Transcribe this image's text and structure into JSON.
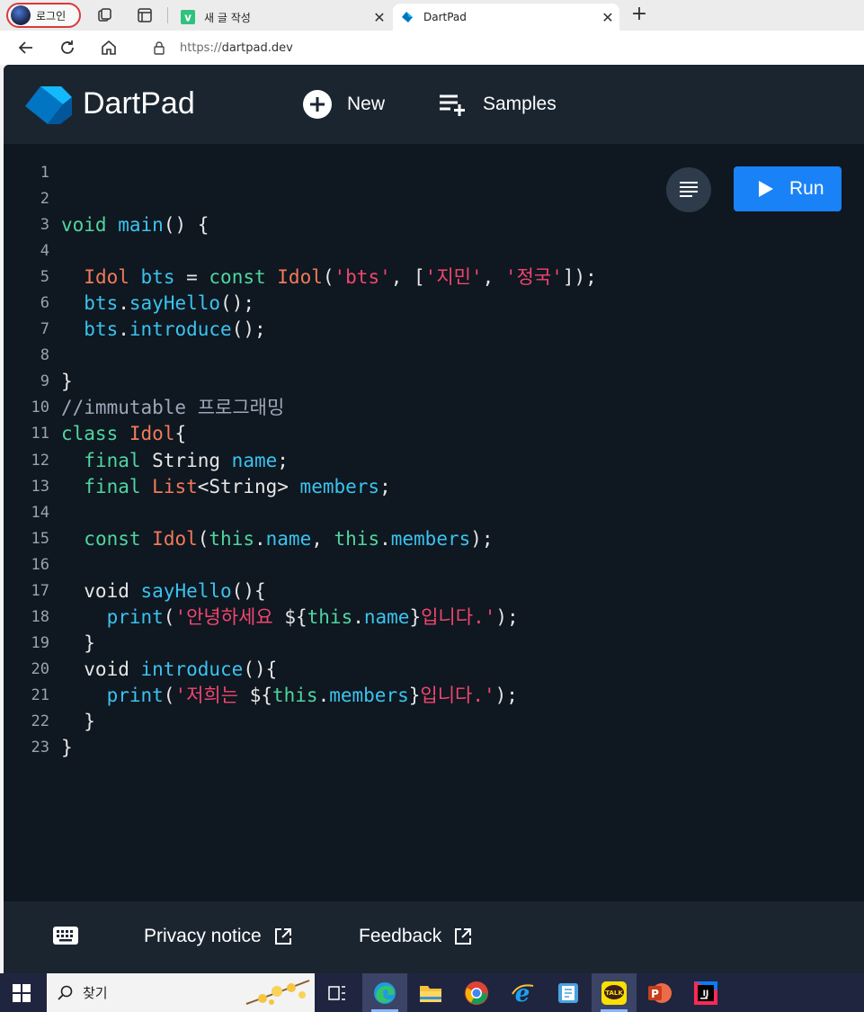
{
  "browser": {
    "profile_label": "로그인",
    "tabs": [
      {
        "title": "새 글 작성",
        "close": "✕",
        "favicon": "vlog-v-icon"
      },
      {
        "title": "DartPad",
        "close": "✕",
        "favicon": "dart-icon"
      }
    ],
    "new_tab": "+",
    "url_protocol": "https://",
    "url_host": "dartpad.dev"
  },
  "dartpad": {
    "brand": "DartPad",
    "new_label": "New",
    "samples_label": "Samples",
    "run_label": "Run",
    "footer": {
      "privacy": "Privacy notice",
      "feedback": "Feedback"
    },
    "colors": {
      "run_button": "#1a82f7",
      "keyword": "#4fd6a0",
      "type": "#f27a5a",
      "identifier": "#3ac3ee",
      "string": "#f0466f",
      "comment": "#9fa6b8"
    }
  },
  "editor": {
    "line_numbers": [
      "1",
      "2",
      "3",
      "4",
      "5",
      "6",
      "7",
      "8",
      "9",
      "10",
      "11",
      "12",
      "13",
      "14",
      "15",
      "16",
      "17",
      "18",
      "19",
      "20",
      "21",
      "22",
      "23"
    ],
    "lines": [
      [],
      [],
      [
        [
          "k",
          "void"
        ],
        [
          "p",
          " "
        ],
        [
          "f",
          "main"
        ],
        [
          "p",
          "() {"
        ]
      ],
      [],
      [
        [
          "p",
          "  "
        ],
        [
          "t",
          "Idol"
        ],
        [
          "p",
          " "
        ],
        [
          "f",
          "bts"
        ],
        [
          "p",
          " = "
        ],
        [
          "k",
          "const"
        ],
        [
          "p",
          " "
        ],
        [
          "t",
          "Idol"
        ],
        [
          "p",
          "("
        ],
        [
          "s",
          "'bts'"
        ],
        [
          "p",
          ", ["
        ],
        [
          "s",
          "'지민'"
        ],
        [
          "p",
          ", "
        ],
        [
          "s",
          "'정국'"
        ],
        [
          "p",
          "]);"
        ]
      ],
      [
        [
          "p",
          "  "
        ],
        [
          "f",
          "bts"
        ],
        [
          "p",
          "."
        ],
        [
          "f",
          "sayHello"
        ],
        [
          "p",
          "();"
        ]
      ],
      [
        [
          "p",
          "  "
        ],
        [
          "f",
          "bts"
        ],
        [
          "p",
          "."
        ],
        [
          "f",
          "introduce"
        ],
        [
          "p",
          "();"
        ]
      ],
      [],
      [
        [
          "p",
          "}"
        ]
      ],
      [
        [
          "c",
          "//immutable 프로그래밍"
        ]
      ],
      [
        [
          "k",
          "class"
        ],
        [
          "p",
          " "
        ],
        [
          "t",
          "Idol"
        ],
        [
          "p",
          "{"
        ]
      ],
      [
        [
          "p",
          "  "
        ],
        [
          "k",
          "final"
        ],
        [
          "p",
          " String "
        ],
        [
          "f",
          "name"
        ],
        [
          "p",
          ";"
        ]
      ],
      [
        [
          "p",
          "  "
        ],
        [
          "k",
          "final"
        ],
        [
          "p",
          " "
        ],
        [
          "t",
          "List"
        ],
        [
          "p",
          "<String> "
        ],
        [
          "f",
          "members"
        ],
        [
          "p",
          ";"
        ]
      ],
      [],
      [
        [
          "p",
          "  "
        ],
        [
          "k",
          "const"
        ],
        [
          "p",
          " "
        ],
        [
          "t",
          "Idol"
        ],
        [
          "p",
          "("
        ],
        [
          "k",
          "this"
        ],
        [
          "p",
          "."
        ],
        [
          "f",
          "name"
        ],
        [
          "p",
          ", "
        ],
        [
          "k",
          "this"
        ],
        [
          "p",
          "."
        ],
        [
          "f",
          "members"
        ],
        [
          "p",
          ");"
        ]
      ],
      [],
      [
        [
          "p",
          "  void "
        ],
        [
          "f",
          "sayHello"
        ],
        [
          "p",
          "(){"
        ]
      ],
      [
        [
          "p",
          "    "
        ],
        [
          "f",
          "print"
        ],
        [
          "p",
          "("
        ],
        [
          "s",
          "'안녕하세요 "
        ],
        [
          "p",
          "${"
        ],
        [
          "k",
          "this"
        ],
        [
          "p",
          "."
        ],
        [
          "f",
          "name"
        ],
        [
          "p",
          "}"
        ],
        [
          "s",
          "입니다.'"
        ],
        [
          "p",
          ");"
        ]
      ],
      [
        [
          "p",
          "  }"
        ]
      ],
      [
        [
          "p",
          "  void "
        ],
        [
          "f",
          "introduce"
        ],
        [
          "p",
          "(){"
        ]
      ],
      [
        [
          "p",
          "    "
        ],
        [
          "f",
          "print"
        ],
        [
          "p",
          "("
        ],
        [
          "s",
          "'저희는 "
        ],
        [
          "p",
          "${"
        ],
        [
          "k",
          "this"
        ],
        [
          "p",
          "."
        ],
        [
          "f",
          "members"
        ],
        [
          "p",
          "}"
        ],
        [
          "s",
          "입니다.'"
        ],
        [
          "p",
          ");"
        ]
      ],
      [
        [
          "p",
          "  }"
        ]
      ],
      [
        [
          "p",
          "}"
        ]
      ]
    ]
  },
  "taskbar": {
    "search_placeholder": "찾기",
    "apps": [
      "task-view-icon",
      "edge-icon",
      "file-explorer-icon",
      "chrome-icon",
      "internet-explorer-icon",
      "notes-app-icon",
      "kakaotalk-icon",
      "powerpoint-icon",
      "intellij-icon"
    ],
    "kakao_label": "TALK",
    "ij_label": "IJ",
    "ppt_label": "P"
  }
}
